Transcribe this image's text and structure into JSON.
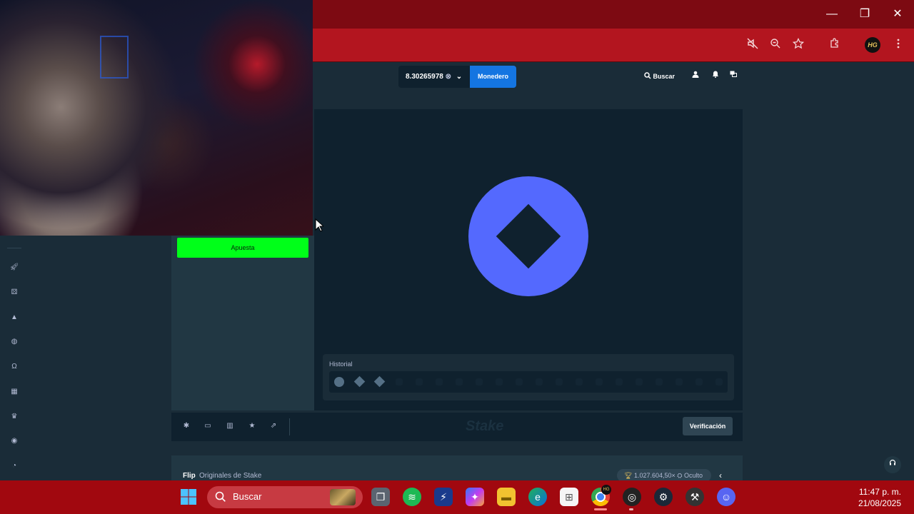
{
  "browser": {
    "window_controls": {
      "minimize": "—",
      "restore": "❐",
      "close": "✕"
    },
    "toolbar_icons": [
      "mute-tab-icon",
      "zoom-icon",
      "bookmark-star-icon",
      "extensions-icon",
      "menu-icon"
    ],
    "profile_initials": "HG"
  },
  "header": {
    "balance": "8.30265978",
    "wallet_label": "Monedero",
    "search_label": "Buscar"
  },
  "controls": {
    "bet_label": "Apuesta"
  },
  "game": {
    "history_label": "Historial",
    "history": [
      "circle",
      "diamond",
      "diamond"
    ]
  },
  "gamebar": {
    "logo_text": "Stake",
    "verify_label": "Verificación"
  },
  "info": {
    "title": "Flip",
    "provider": "Originales de Stake",
    "max_win": "1.027.604,50× ",
    "hidden_label": "Oculto"
  },
  "taskbar": {
    "search_placeholder": "Buscar",
    "time": "11:47 p. m.",
    "date": "21/08/2025",
    "profile_badge": "HG"
  },
  "colors": {
    "accent_blue": "#1475e1",
    "bet_green": "#00ff19",
    "coin_blue": "#5469fe",
    "chrome_red": "#b3151f"
  }
}
